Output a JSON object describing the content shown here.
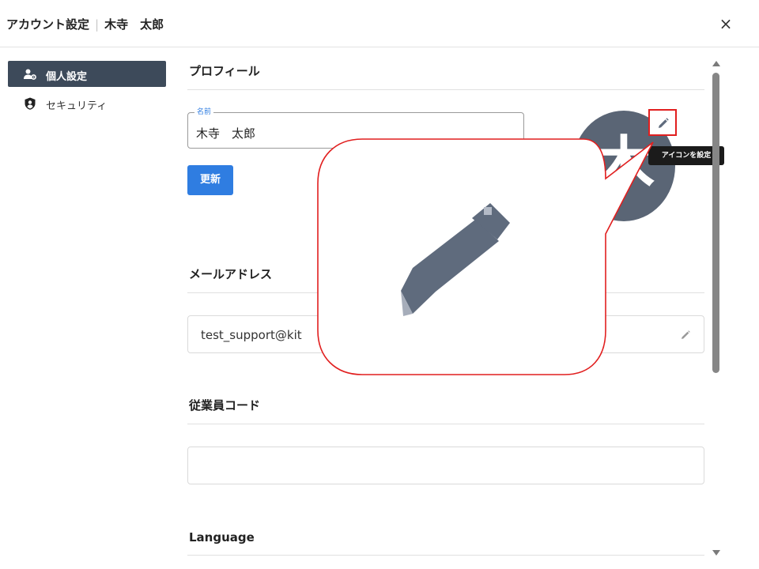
{
  "header": {
    "title": "アカウント設定",
    "separator": "|",
    "user_name": "木寺　太郎",
    "close_icon": "×"
  },
  "sidebar": {
    "items": [
      {
        "label": "個人設定",
        "icon": "person-gear-icon",
        "active": true
      },
      {
        "label": "セキュリティ",
        "icon": "security-shield-icon",
        "active": false
      }
    ]
  },
  "profile": {
    "section_title": "プロフィール",
    "name_legend": "名前",
    "name_value": "木寺　太郎",
    "update_button": "更新",
    "avatar_initial": "木",
    "avatar_edit_icon": "pencil-icon",
    "tooltip": "アイコンを設定"
  },
  "email": {
    "section_title": "メールアドレス",
    "value": "test_support@kit",
    "edit_icon": "pencil-icon"
  },
  "employee_code": {
    "section_title": "従業員コード",
    "value": ""
  },
  "language": {
    "section_title": "Language"
  },
  "colors": {
    "accent": "#2f7de1",
    "sidebar_active": "#3d4a5a",
    "avatar_bg": "#5a6575",
    "highlight": "#e11f1f"
  }
}
